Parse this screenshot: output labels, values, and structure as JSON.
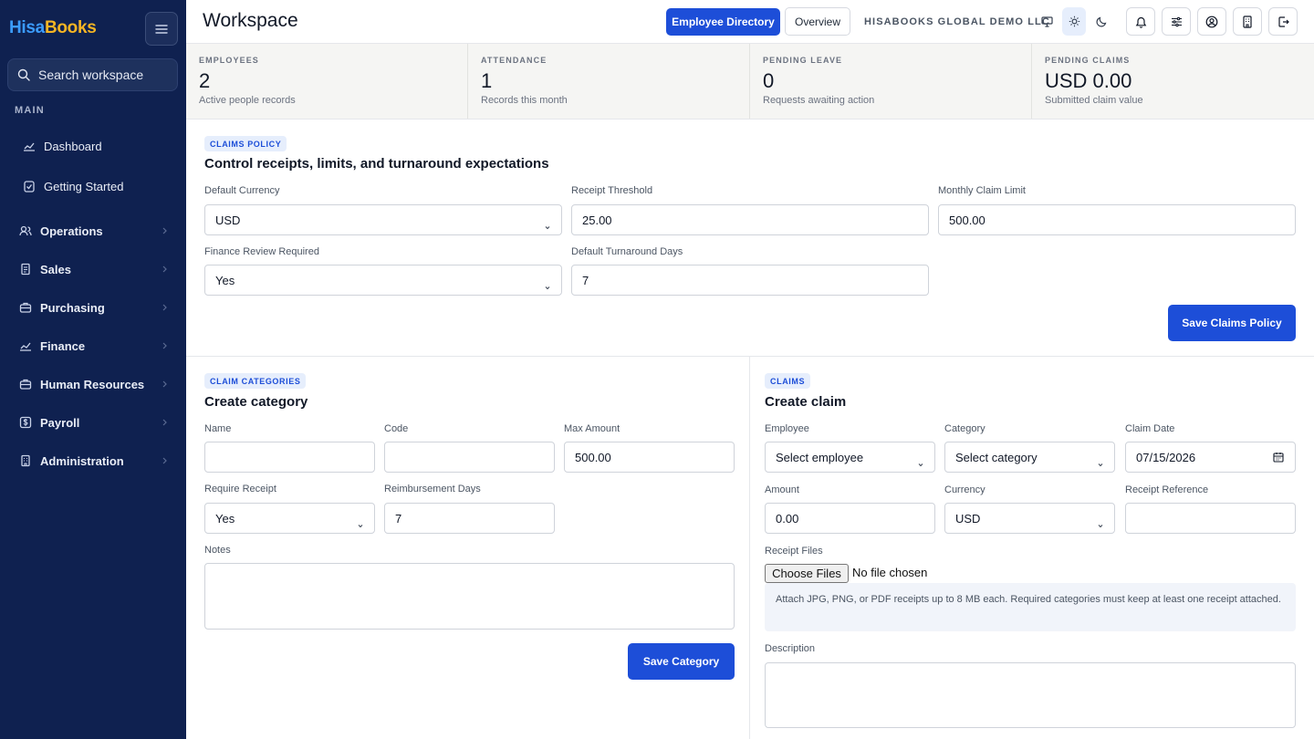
{
  "sidebar": {
    "logo_part1": "Hisa",
    "logo_part2": "Books",
    "search_placeholder": "Search workspace",
    "section_label": "MAIN",
    "items": [
      {
        "label": "Dashboard",
        "icon": "chart-line-icon"
      },
      {
        "label": "Getting Started",
        "icon": "clipboard-check-icon"
      },
      {
        "label": "Operations",
        "icon": "users-icon"
      },
      {
        "label": "Sales",
        "icon": "receipt-icon"
      },
      {
        "label": "Purchasing",
        "icon": "briefcase-icon"
      },
      {
        "label": "Finance",
        "icon": "chart-line-icon"
      },
      {
        "label": "Human Resources",
        "icon": "briefcase-icon"
      },
      {
        "label": "Payroll",
        "icon": "dollar-icon"
      },
      {
        "label": "Administration",
        "icon": "building-icon"
      }
    ]
  },
  "header": {
    "title": "Workspace",
    "primary_button": "Employee Directory",
    "secondary_button": "Overview",
    "company": "HISABOOKS GLOBAL DEMO LLC"
  },
  "stats": [
    {
      "label": "EMPLOYEES",
      "value": "2",
      "sub": "Active people records"
    },
    {
      "label": "ATTENDANCE",
      "value": "1",
      "sub": "Records this month"
    },
    {
      "label": "PENDING LEAVE",
      "value": "0",
      "sub": "Requests awaiting action"
    },
    {
      "label": "PENDING CLAIMS",
      "value": "USD 0.00",
      "sub": "Submitted claim value"
    }
  ],
  "policy": {
    "badge": "CLAIMS POLICY",
    "title": "Control receipts, limits, and turnaround expectations",
    "default_currency_label": "Default Currency",
    "default_currency_value": "USD",
    "receipt_threshold_label": "Receipt Threshold",
    "receipt_threshold_value": "25.00",
    "monthly_limit_label": "Monthly Claim Limit",
    "monthly_limit_value": "500.00",
    "finance_review_label": "Finance Review Required",
    "finance_review_value": "Yes",
    "turnaround_label": "Default Turnaround Days",
    "turnaround_value": "7",
    "save_button": "Save Claims Policy"
  },
  "category": {
    "badge": "CLAIM CATEGORIES",
    "title": "Create category",
    "name_label": "Name",
    "name_value": "",
    "code_label": "Code",
    "code_value": "",
    "max_amount_label": "Max Amount",
    "max_amount_value": "500.00",
    "require_receipt_label": "Require Receipt",
    "require_receipt_value": "Yes",
    "reimb_days_label": "Reimbursement Days",
    "reimb_days_value": "7",
    "notes_label": "Notes",
    "notes_value": "",
    "save_button": "Save Category"
  },
  "claim": {
    "badge": "CLAIMS",
    "title": "Create claim",
    "employee_label": "Employee",
    "employee_value": "Select employee",
    "category_label": "Category",
    "category_value": "Select category",
    "date_label": "Claim Date",
    "date_value": "07/15/2026",
    "amount_label": "Amount",
    "amount_value": "0.00",
    "currency_label": "Currency",
    "currency_value": "USD",
    "receipt_ref_label": "Receipt Reference",
    "receipt_ref_value": "",
    "files_label": "Receipt Files",
    "choose_files_button": "Choose Files",
    "files_status": "No file chosen",
    "files_hint": "Attach JPG, PNG, or PDF receipts up to 8 MB each. Required categories must keep at least one receipt attached.",
    "description_label": "Description",
    "description_value": ""
  },
  "colors": {
    "sidebar_bg": "#0f2150",
    "accent": "#1d4ed8",
    "logo_blue": "#3b9cff",
    "logo_gold": "#f5b524"
  }
}
